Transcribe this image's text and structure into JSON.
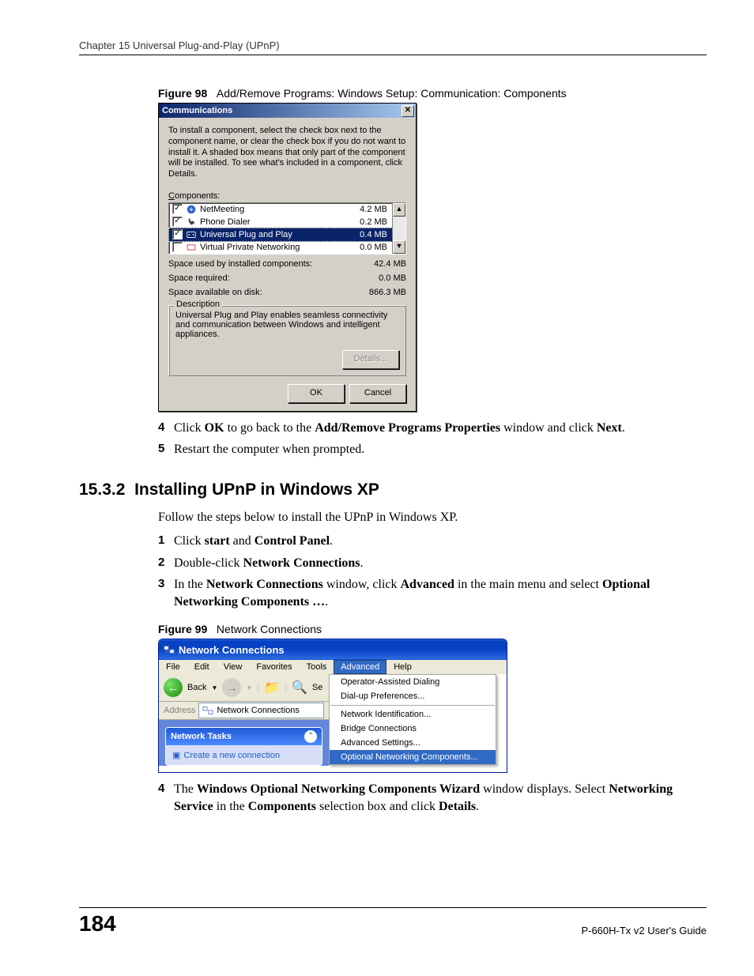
{
  "header": {
    "chapter": "Chapter 15 Universal Plug-and-Play (UPnP)"
  },
  "fig98": {
    "label": "Figure 98",
    "caption": "Add/Remove Programs: Windows Setup: Communication: Components",
    "dialog": {
      "title": "Communications",
      "close_glyph": "✕",
      "instructions": "To install a component, select the check box next to the component name, or clear the check box if you do not want to install it. A shaded box means that only part of the component will be installed. To see what's included in a component, click Details.",
      "components_label_pre": "C",
      "components_label_post": "omponents:",
      "items": [
        {
          "checked": true,
          "name": "NetMeeting",
          "size": "4.2 MB",
          "selected": false
        },
        {
          "checked": true,
          "name": "Phone Dialer",
          "size": "0.2 MB",
          "selected": false
        },
        {
          "checked": true,
          "name": "Universal Plug and Play",
          "size": "0.4 MB",
          "selected": true
        },
        {
          "checked": false,
          "name": "Virtual Private Networking",
          "size": "0.0 MB",
          "selected": false
        }
      ],
      "scroll_up": "▲",
      "scroll_down": "▼",
      "kv": {
        "used_label": "Space used by installed components:",
        "used_value": "42.4 MB",
        "req_label": "Space required:",
        "req_value": "0.0 MB",
        "avail_label": "Space available on disk:",
        "avail_value": "866.3 MB"
      },
      "desc_legend": "Description",
      "desc_text": "Universal Plug and Play enables seamless connectivity and communication between Windows and intelligent appliances.",
      "details_btn": "Details...",
      "ok_btn": "OK",
      "cancel_btn": "Cancel"
    }
  },
  "steps_a": [
    {
      "num": "4",
      "pre": "Click ",
      "b1": "OK",
      "mid": " to go back to the ",
      "b2": "Add/Remove Programs Properties",
      "post": " window and click ",
      "b3": "Next",
      "end": "."
    },
    {
      "num": "5",
      "plain": "Restart the computer when prompted."
    }
  ],
  "section": {
    "num": "15.3.2",
    "title": "Installing UPnP in Windows XP"
  },
  "para": "Follow the steps below to install the UPnP in Windows XP.",
  "steps_b": [
    {
      "num": "1",
      "pre": "Click ",
      "b1": "start",
      "mid": " and ",
      "b2": "Control Panel",
      "end": "."
    },
    {
      "num": "2",
      "pre": "Double-click ",
      "b1": "Network Connections",
      "end": "."
    },
    {
      "num": "3",
      "pre": "In the ",
      "b1": "Network Connections",
      "mid": " window, click ",
      "b2": "Advanced",
      "post": " in the main menu and select ",
      "b3": "Optional Networking Components …",
      "end": "."
    }
  ],
  "fig99": {
    "label": "Figure 99",
    "caption": "Network Connections",
    "window": {
      "title": "Network Connections",
      "menus": [
        "File",
        "Edit",
        "View",
        "Favorites",
        "Tools",
        "Advanced",
        "Help"
      ],
      "open_index": 5,
      "toolbar": {
        "back": "Back",
        "fwd": "→",
        "up": "⤴",
        "folders": "📁",
        "search": "🔍",
        "search_label": "Se"
      },
      "address_label": "Address",
      "address_value": "Network Connections",
      "tasks_header": "Network Tasks",
      "tasks_chevron": "«",
      "tasks_item": "Create a new connection",
      "dropdown": [
        "Operator-Assisted Dialing",
        "Dial-up Preferences...",
        "---",
        "Network Identification...",
        "Bridge Connections",
        "Advanced Settings...",
        "Optional Networking Components..."
      ],
      "hl_index": 6
    }
  },
  "steps_c": [
    {
      "num": "4",
      "pre": "The ",
      "b1": "Windows Optional Networking Components Wizard",
      "mid": " window displays. Select ",
      "b2": "Networking Service",
      "post": " in the ",
      "b3": "Components",
      "post2": " selection box and click ",
      "b4": "Details",
      "end": "."
    }
  ],
  "footer": {
    "page": "184",
    "guide": "P-660H-Tx v2 User's Guide"
  }
}
